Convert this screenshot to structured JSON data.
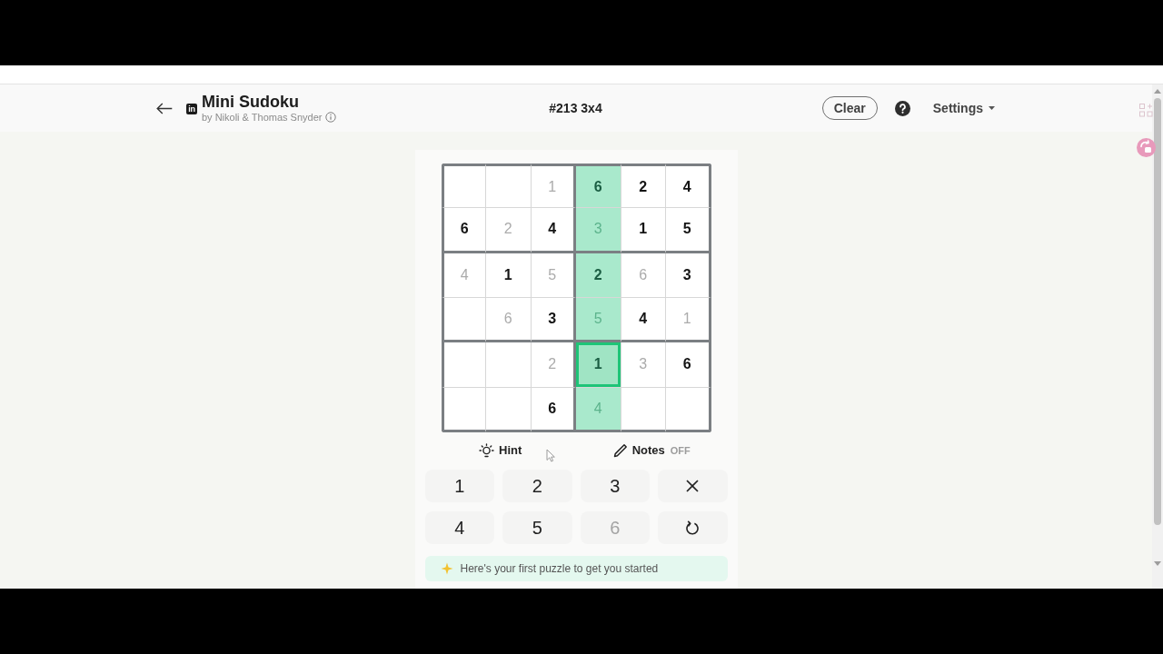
{
  "header": {
    "logo": "in",
    "title": "Mini Sudoku",
    "byline": "by Nikoli & Thomas Snyder",
    "puzzle": "#213 3x4",
    "clear_button": "Clear",
    "settings": "Settings"
  },
  "board": {
    "rows": [
      [
        {
          "kind": "blank",
          "highlighted": false,
          "selected": false
        },
        {
          "kind": "blank",
          "highlighted": false,
          "selected": false
        },
        {
          "kind": "entry",
          "value": "1",
          "highlighted": false,
          "selected": false
        },
        {
          "kind": "given",
          "value": "6",
          "highlighted": true,
          "selected": false
        },
        {
          "kind": "given",
          "value": "2",
          "highlighted": false,
          "selected": false
        },
        {
          "kind": "given",
          "value": "4",
          "highlighted": false,
          "selected": false
        }
      ],
      [
        {
          "kind": "given",
          "value": "6",
          "highlighted": false,
          "selected": false
        },
        {
          "kind": "entry",
          "value": "2",
          "highlighted": false,
          "selected": false
        },
        {
          "kind": "given",
          "value": "4",
          "highlighted": false,
          "selected": false
        },
        {
          "kind": "entry",
          "value": "3",
          "highlighted": true,
          "selected": false
        },
        {
          "kind": "given",
          "value": "1",
          "highlighted": false,
          "selected": false
        },
        {
          "kind": "given",
          "value": "5",
          "highlighted": false,
          "selected": false
        }
      ],
      [
        {
          "kind": "entry",
          "value": "4",
          "highlighted": false,
          "selected": false
        },
        {
          "kind": "given",
          "value": "1",
          "highlighted": false,
          "selected": false
        },
        {
          "kind": "entry",
          "value": "5",
          "highlighted": false,
          "selected": false
        },
        {
          "kind": "given",
          "value": "2",
          "highlighted": true,
          "selected": false
        },
        {
          "kind": "entry",
          "value": "6",
          "highlighted": false,
          "selected": false
        },
        {
          "kind": "given",
          "value": "3",
          "highlighted": false,
          "selected": false
        }
      ],
      [
        {
          "kind": "blank",
          "highlighted": false,
          "selected": false
        },
        {
          "kind": "entry",
          "value": "6",
          "highlighted": false,
          "selected": false
        },
        {
          "kind": "given",
          "value": "3",
          "highlighted": false,
          "selected": false
        },
        {
          "kind": "entry",
          "value": "5",
          "highlighted": true,
          "selected": false
        },
        {
          "kind": "given",
          "value": "4",
          "highlighted": false,
          "selected": false
        },
        {
          "kind": "entry",
          "value": "1",
          "highlighted": false,
          "selected": false
        }
      ],
      [
        {
          "kind": "blank",
          "highlighted": false,
          "selected": false
        },
        {
          "kind": "blank",
          "highlighted": false,
          "selected": false
        },
        {
          "kind": "entry",
          "value": "2",
          "highlighted": false,
          "selected": false
        },
        {
          "kind": "given",
          "value": "1",
          "highlighted": true,
          "selected": true
        },
        {
          "kind": "entry",
          "value": "3",
          "highlighted": false,
          "selected": false
        },
        {
          "kind": "given",
          "value": "6",
          "highlighted": false,
          "selected": false
        }
      ],
      [
        {
          "kind": "blank",
          "highlighted": false,
          "selected": false
        },
        {
          "kind": "blank",
          "highlighted": false,
          "selected": false
        },
        {
          "kind": "given",
          "value": "6",
          "highlighted": false,
          "selected": false
        },
        {
          "kind": "entry",
          "value": "4",
          "highlighted": true,
          "selected": false
        },
        {
          "kind": "blank",
          "highlighted": false,
          "selected": false
        },
        {
          "kind": "blank",
          "highlighted": false,
          "selected": false
        }
      ]
    ]
  },
  "tools": [
    {
      "kind": "hint",
      "label": "Hint"
    },
    {
      "kind": "notes",
      "label": "Notes",
      "state": "OFF",
      "on": false
    }
  ],
  "keypad": [
    {
      "kind": "digit",
      "label": "1",
      "disabled": false
    },
    {
      "kind": "digit",
      "label": "2",
      "disabled": false
    },
    {
      "kind": "digit",
      "label": "3",
      "disabled": false
    },
    {
      "kind": "erase",
      "disabled": false
    },
    {
      "kind": "digit",
      "label": "4",
      "disabled": false
    },
    {
      "kind": "digit",
      "label": "5",
      "disabled": false
    },
    {
      "kind": "digit",
      "label": "6",
      "disabled": true
    },
    {
      "kind": "undo",
      "disabled": false
    }
  ],
  "banner": {
    "text": "Here's your first puzzle to get you started"
  }
}
